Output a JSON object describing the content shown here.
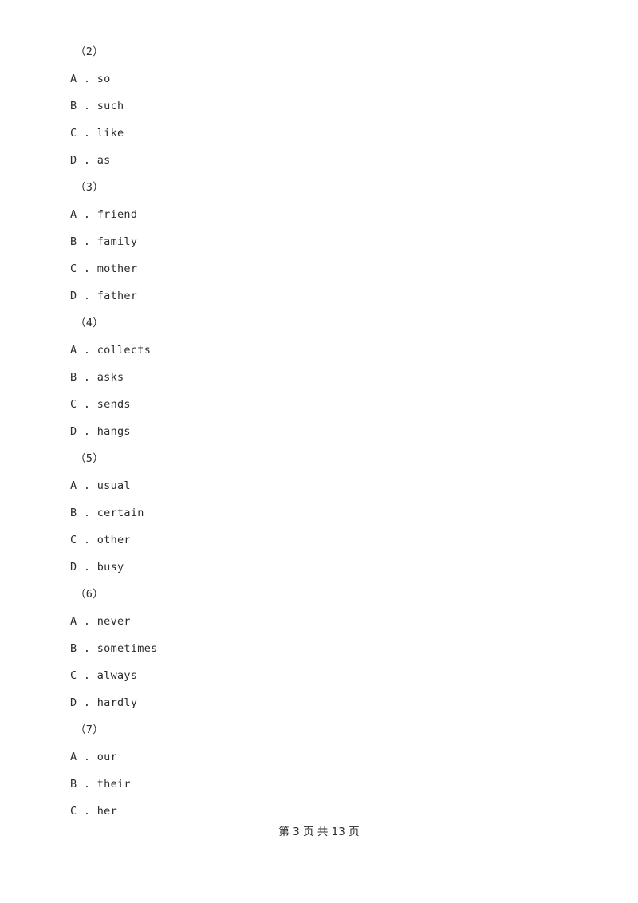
{
  "document": {
    "background_color": "#ffffff",
    "text_color": "#2b2b2b"
  },
  "body_lines": [
    {
      "kind": "question-number",
      "text": "（2）"
    },
    {
      "kind": "option",
      "text": "A . so"
    },
    {
      "kind": "option",
      "text": "B . such"
    },
    {
      "kind": "option",
      "text": "C . like"
    },
    {
      "kind": "option",
      "text": "D . as"
    },
    {
      "kind": "question-number",
      "text": "（3）"
    },
    {
      "kind": "option",
      "text": "A . friend"
    },
    {
      "kind": "option",
      "text": "B . family"
    },
    {
      "kind": "option",
      "text": "C . mother"
    },
    {
      "kind": "option",
      "text": "D . father"
    },
    {
      "kind": "question-number",
      "text": "（4）"
    },
    {
      "kind": "option",
      "text": "A . collects"
    },
    {
      "kind": "option",
      "text": "B . asks"
    },
    {
      "kind": "option",
      "text": "C . sends"
    },
    {
      "kind": "option",
      "text": "D . hangs"
    },
    {
      "kind": "question-number",
      "text": "（5）"
    },
    {
      "kind": "option",
      "text": "A . usual"
    },
    {
      "kind": "option",
      "text": "B . certain"
    },
    {
      "kind": "option",
      "text": "C . other"
    },
    {
      "kind": "option",
      "text": "D . busy"
    },
    {
      "kind": "question-number",
      "text": "（6）"
    },
    {
      "kind": "option",
      "text": "A . never"
    },
    {
      "kind": "option",
      "text": "B . sometimes"
    },
    {
      "kind": "option",
      "text": "C . always"
    },
    {
      "kind": "option",
      "text": "D . hardly"
    },
    {
      "kind": "question-number",
      "text": "（7）"
    },
    {
      "kind": "option",
      "text": "A . our"
    },
    {
      "kind": "option",
      "text": "B . their"
    },
    {
      "kind": "option",
      "text": "C . her"
    }
  ],
  "footer": {
    "text": "第 3 页 共 13 页",
    "current_page": "3",
    "total_pages": "13"
  }
}
